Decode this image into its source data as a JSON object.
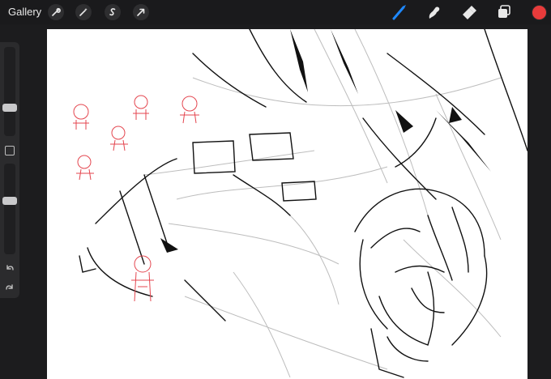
{
  "toolbar": {
    "gallery_label": "Gallery",
    "left_tools": [
      "actions-icon",
      "adjustments-icon",
      "selection-icon",
      "transform-icon"
    ],
    "right_tools": [
      "brush-icon",
      "smudge-icon",
      "eraser-icon",
      "layers-icon"
    ],
    "active_tool": "brush-icon",
    "current_color": "#e73b3b",
    "accent_color": "#1e88ff"
  },
  "sidebar": {
    "brush_size_level": 0.3,
    "opacity_level": 0.6
  },
  "canvas": {
    "background": "#ffffff",
    "ink_color": "#111111",
    "sketch_color": "#bdbdbd",
    "red_sketch_color": "#e4464f"
  }
}
